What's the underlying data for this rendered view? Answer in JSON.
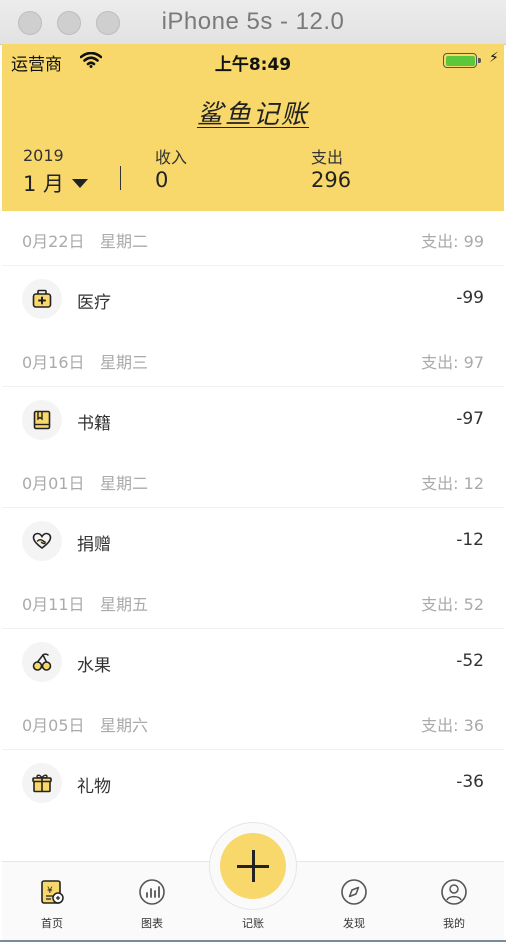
{
  "window": {
    "title": "iPhone 5s - 12.0"
  },
  "status": {
    "carrier": "运营商",
    "time": "上午8:49"
  },
  "header": {
    "app_title": "鲨鱼记账",
    "year": "2019",
    "month": "1 月",
    "income_label": "收入",
    "income_value": "0",
    "expense_label": "支出",
    "expense_value": "296"
  },
  "days": [
    {
      "date": "0月22日",
      "weekday": "星期二",
      "summary": "支出: 99",
      "item": {
        "icon": "medical-kit-icon",
        "name": "医疗",
        "amount": "-99"
      }
    },
    {
      "date": "0月16日",
      "weekday": "星期三",
      "summary": "支出: 97",
      "item": {
        "icon": "book-icon",
        "name": "书籍",
        "amount": "-97"
      }
    },
    {
      "date": "0月01日",
      "weekday": "星期二",
      "summary": "支出: 12",
      "item": {
        "icon": "heart-hand-icon",
        "name": "捐赠",
        "amount": "-12"
      }
    },
    {
      "date": "0月11日",
      "weekday": "星期五",
      "summary": "支出: 52",
      "item": {
        "icon": "cherry-icon",
        "name": "水果",
        "amount": "-52"
      }
    },
    {
      "date": "0月05日",
      "weekday": "星期六",
      "summary": "支出: 36",
      "item": {
        "icon": "gift-icon",
        "name": "礼物",
        "amount": "-36"
      }
    }
  ],
  "tabs": {
    "home": "首页",
    "charts": "图表",
    "record": "记账",
    "discover": "发现",
    "mine": "我的"
  },
  "colors": {
    "accent": "#f8d86b",
    "text": "#333333",
    "muted": "#aaaaaa"
  }
}
